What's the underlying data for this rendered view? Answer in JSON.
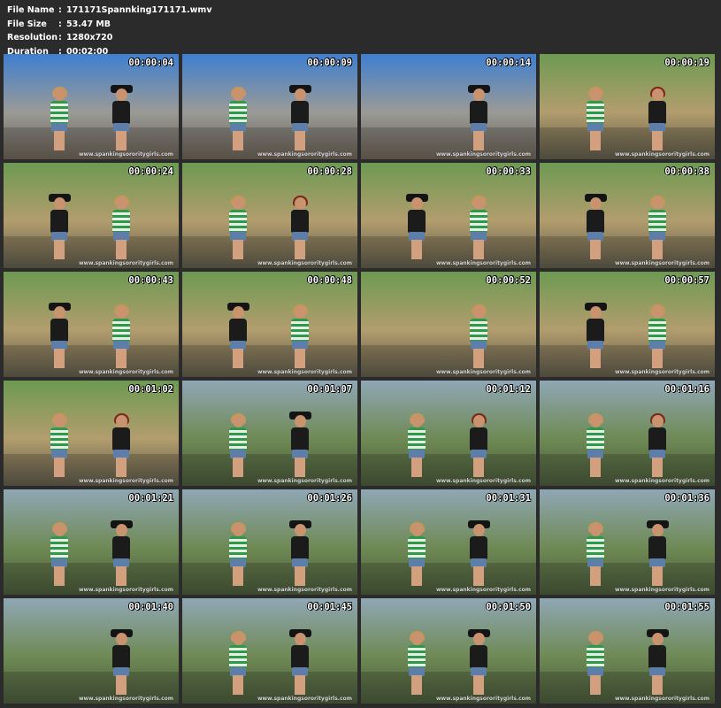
{
  "file_info": [
    {
      "label": "File Name",
      "sep": ":",
      "value": "171171Spannking171171.wmv"
    },
    {
      "label": "File Size",
      "sep": ":",
      "value": "53.47 MB"
    },
    {
      "label": "Resolution",
      "sep": ":",
      "value": "1280x720"
    },
    {
      "label": "Duration",
      "sep": ":",
      "value": "00:02:00"
    }
  ],
  "watermark": "www.spankingsororitygirls.com",
  "thumbnails": [
    {
      "timestamp": "00:00:04",
      "scene": "car",
      "figures": [
        "green-blond",
        "black-hat"
      ]
    },
    {
      "timestamp": "00:00:09",
      "scene": "car",
      "figures": [
        "green-blond",
        "black-hat"
      ]
    },
    {
      "timestamp": "00:00:14",
      "scene": "car",
      "figures": [
        "black-hat"
      ]
    },
    {
      "timestamp": "00:00:19",
      "scene": "fence",
      "figures": [
        "green-blond",
        "black-red"
      ]
    },
    {
      "timestamp": "00:00:24",
      "scene": "fence",
      "figures": [
        "black-hat",
        "green-blond"
      ]
    },
    {
      "timestamp": "00:00:28",
      "scene": "fence",
      "figures": [
        "green-blond",
        "black-red"
      ]
    },
    {
      "timestamp": "00:00:33",
      "scene": "fence",
      "figures": [
        "black-hat",
        "green-blond"
      ]
    },
    {
      "timestamp": "00:00:38",
      "scene": "fence",
      "figures": [
        "black-hat",
        "green-blond"
      ]
    },
    {
      "timestamp": "00:00:43",
      "scene": "fence",
      "figures": [
        "black-hat",
        "green-blond"
      ]
    },
    {
      "timestamp": "00:00:48",
      "scene": "fence",
      "figures": [
        "black-hat",
        "green-blond"
      ]
    },
    {
      "timestamp": "00:00:52",
      "scene": "fence",
      "figures": [
        "green-blond"
      ]
    },
    {
      "timestamp": "00:00:57",
      "scene": "fence",
      "figures": [
        "black-hat",
        "green-blond"
      ]
    },
    {
      "timestamp": "00:01:02",
      "scene": "fence",
      "figures": [
        "green-blond",
        "black-red"
      ]
    },
    {
      "timestamp": "00:01:07",
      "scene": "tree",
      "figures": [
        "green-blond",
        "black-hat"
      ]
    },
    {
      "timestamp": "00:01:12",
      "scene": "tree",
      "figures": [
        "green-blond",
        "black-red"
      ]
    },
    {
      "timestamp": "00:01:16",
      "scene": "tree",
      "figures": [
        "green-blond",
        "black-red"
      ]
    },
    {
      "timestamp": "00:01:21",
      "scene": "tree",
      "figures": [
        "green-blond",
        "black-hat"
      ]
    },
    {
      "timestamp": "00:01:26",
      "scene": "tree",
      "figures": [
        "green-blond",
        "black-hat"
      ]
    },
    {
      "timestamp": "00:01:31",
      "scene": "tree",
      "figures": [
        "green-blond",
        "black-hat"
      ]
    },
    {
      "timestamp": "00:01:36",
      "scene": "tree",
      "figures": [
        "green-blond",
        "black-hat"
      ]
    },
    {
      "timestamp": "00:01:40",
      "scene": "tree",
      "figures": [
        "black-hat"
      ]
    },
    {
      "timestamp": "00:01:45",
      "scene": "tree",
      "figures": [
        "green-blond",
        "black-hat"
      ]
    },
    {
      "timestamp": "00:01:50",
      "scene": "tree",
      "figures": [
        "green-blond",
        "black-hat"
      ]
    },
    {
      "timestamp": "00:01:55",
      "scene": "tree",
      "figures": [
        "green-blond",
        "black-hat"
      ]
    }
  ],
  "colors": {
    "background": "#2b2b2b",
    "text": "#ffffff",
    "scene_car": [
      "#3f7fd0",
      "#9a9a96",
      "#6b6256"
    ],
    "scene_fence": [
      "#6d9a52",
      "#b29d6e",
      "#5e5a4a"
    ],
    "scene_tree": [
      "#8fa7b5",
      "#6f8a55",
      "#4a5a3a"
    ]
  }
}
